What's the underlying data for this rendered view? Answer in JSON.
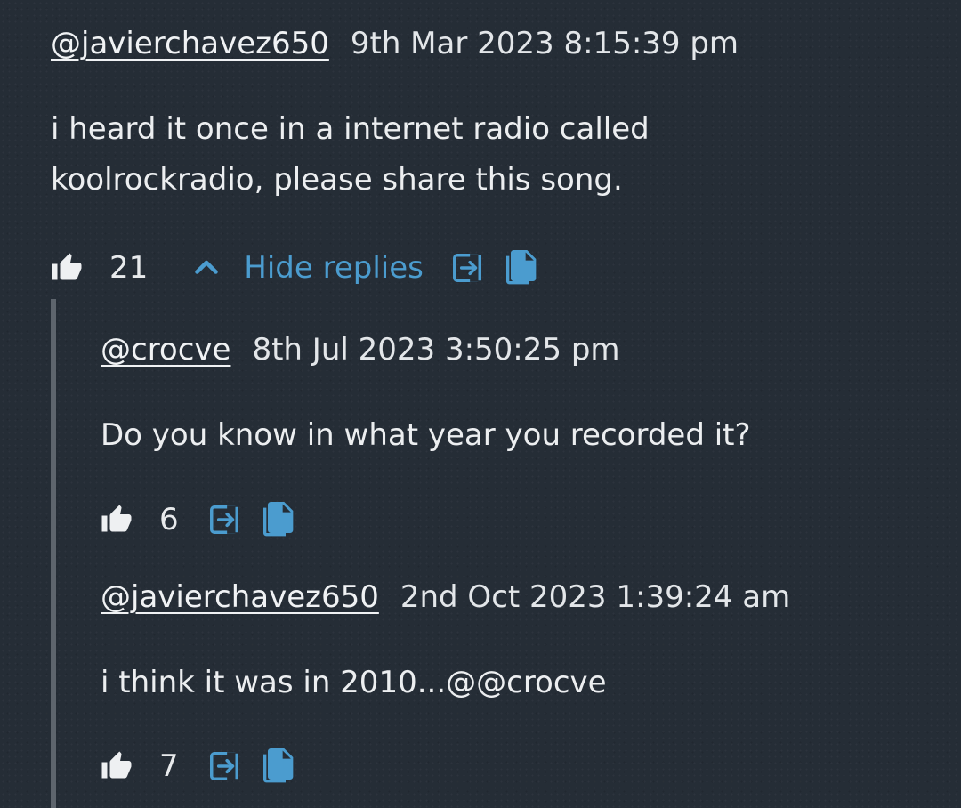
{
  "comments": [
    {
      "author": "@javierchavez650",
      "date": "9th Mar 2023 8:15:39 pm",
      "text_lines": [
        "i heard it once in a internet radio called",
        "koolrockradio, please share this song."
      ],
      "likes": "21",
      "hide_replies_label": "Hide replies"
    }
  ],
  "replies": [
    {
      "author": "@crocve",
      "date": "8th Jul 2023 3:50:25 pm",
      "text": "Do you know in what year you recorded it?",
      "likes": "6"
    },
    {
      "author": "@javierchavez650",
      "date": "2nd Oct 2023 1:39:24 am",
      "text": "i think it was in 2010...@@crocve",
      "likes": "7"
    }
  ],
  "icons": {
    "like": "thumbs-up-icon",
    "chevron": "chevron-up-icon",
    "open": "open-in-icon",
    "copy": "copy-icon"
  },
  "colors": {
    "background": "#252d36",
    "accent": "#4b9ccf",
    "text": "#e8eaec",
    "thread_line": "#5e656d"
  }
}
